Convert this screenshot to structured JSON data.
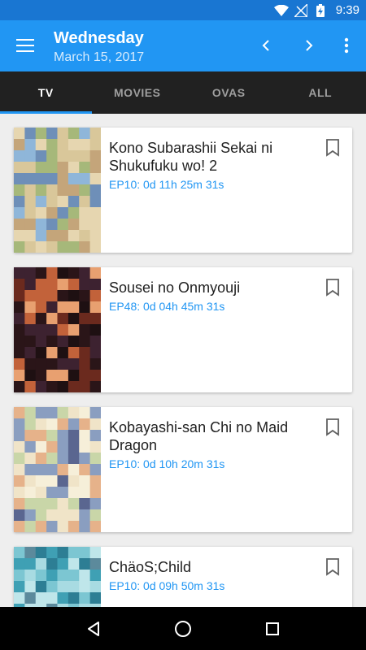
{
  "status": {
    "time": "9:39"
  },
  "appbar": {
    "title": "Wednesday",
    "date": "March 15, 2017"
  },
  "tabs": [
    {
      "label": "TV",
      "active": true
    },
    {
      "label": "MOVIES",
      "active": false
    },
    {
      "label": "OVAS",
      "active": false
    },
    {
      "label": "ALL",
      "active": false
    }
  ],
  "items": [
    {
      "title": "Kono Subarashii Sekai ni Shukufuku wo! 2",
      "episode": "EP10: 0d 11h 25m 31s",
      "thumb_colors": [
        "#d9c79a",
        "#8fb6d9",
        "#c4a57a",
        "#6e8fb8",
        "#e6d6b0",
        "#a6b87a"
      ]
    },
    {
      "title": "Sousei no Onmyouji",
      "episode": "EP48: 0d 04h 45m 31s",
      "thumb_colors": [
        "#2a1518",
        "#6b2a1e",
        "#c2623a",
        "#3d2230",
        "#e8a070",
        "#1e1012"
      ]
    },
    {
      "title": "Kobayashi-san Chi no Maid Dragon",
      "episode": "EP10: 0d 10h 20m 31s",
      "thumb_colors": [
        "#f0e4c8",
        "#8a9ec0",
        "#e6b28a",
        "#5a6690",
        "#c9d6a8",
        "#f6efd9"
      ]
    },
    {
      "title": "ChäoS;Child",
      "episode": "EP10: 0d 09h 50m 31s",
      "thumb_colors": [
        "#3fa0b4",
        "#7cc6d2",
        "#2d7e94",
        "#a8dbe2",
        "#5c8a9c",
        "#bfe6ea"
      ]
    }
  ]
}
